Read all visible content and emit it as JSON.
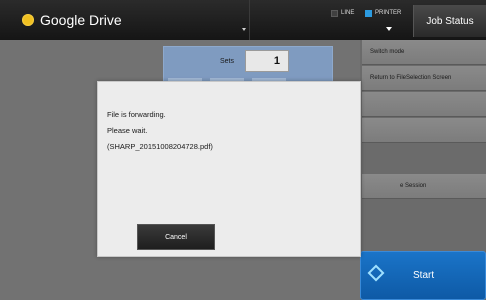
{
  "header": {
    "app_title": "Google Drive",
    "line_label": "LINE",
    "printer_label": "PRINTER",
    "job_status_label": "Job Status"
  },
  "copy_panel": {
    "sets_label": "Sets",
    "sets_value": "1"
  },
  "right_menu": {
    "items": [
      "Switch mode",
      "Return to FileSelection Screen",
      "",
      "",
      "e Session"
    ],
    "start_label": "Start"
  },
  "dialog": {
    "line1": "File is forwarding.",
    "line2": "Please wait.",
    "line3": "(SHARP_20151008204728.pdf)",
    "cancel_label": "Cancel"
  },
  "colors": {
    "accent_blue": "#1a74c8",
    "drive_icon": "#f0c020",
    "printer_indicator": "#2c9be0"
  }
}
